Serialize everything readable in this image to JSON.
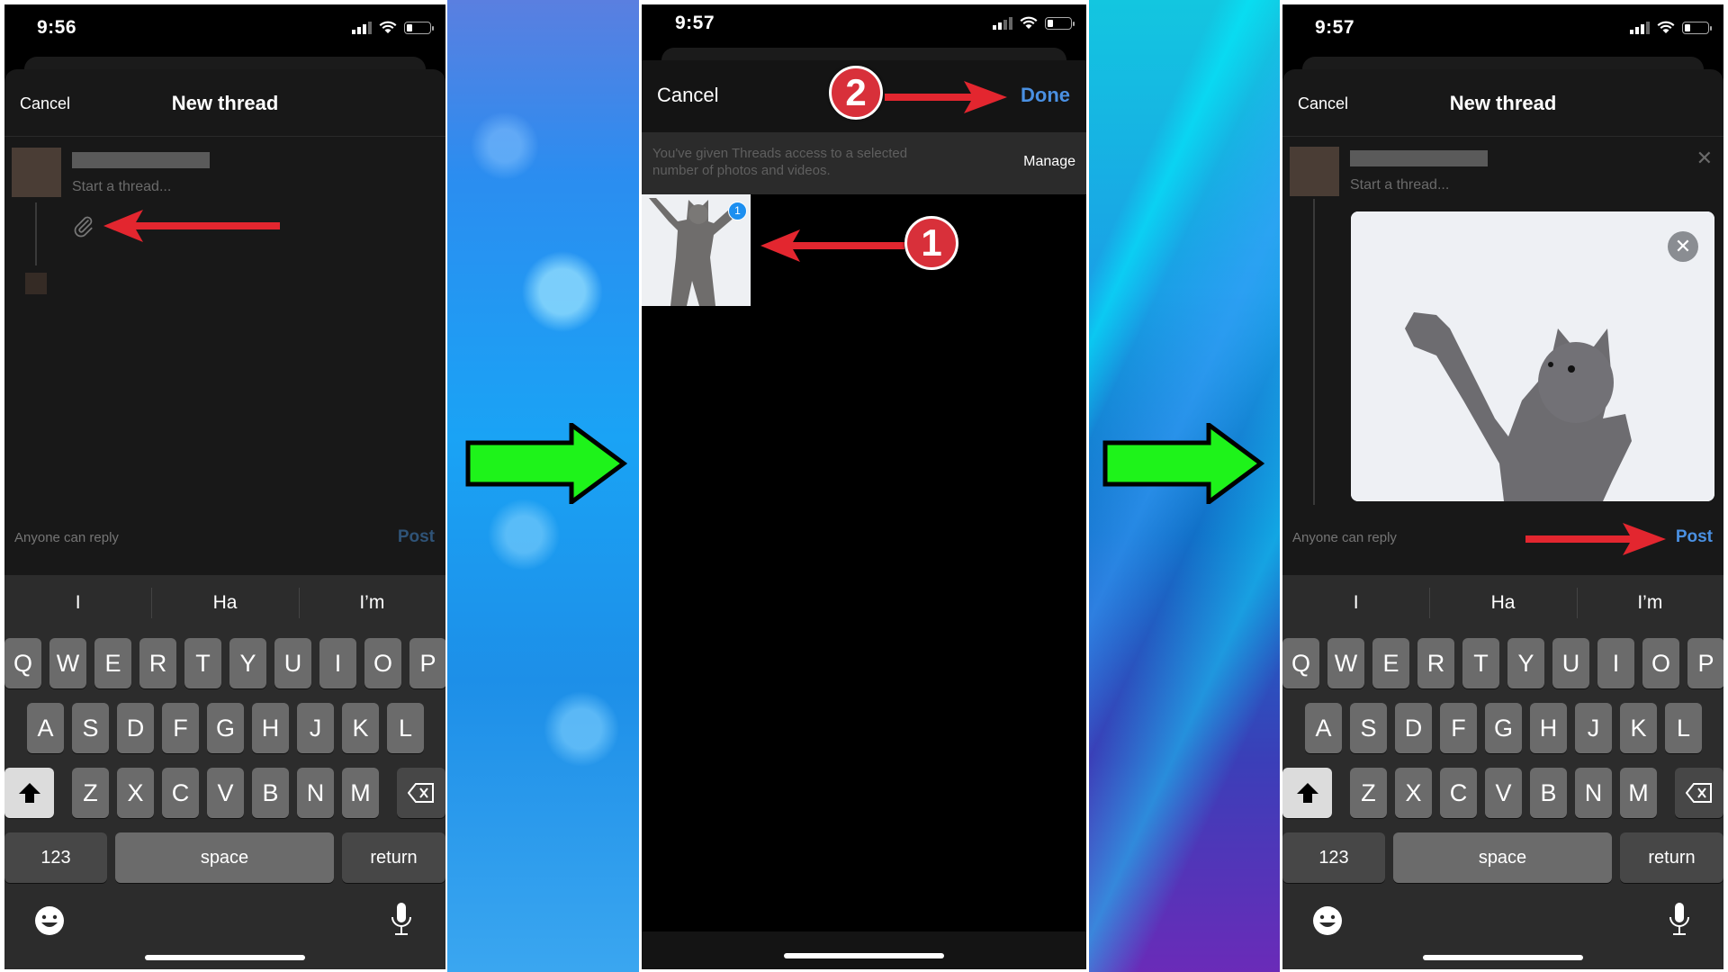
{
  "colors": {
    "accent_blue": "#4a90e2",
    "post_disabled": "#2f5377",
    "annotation_red": "#e3262f",
    "transition_arrow": "#1ef31a"
  },
  "screens": [
    {
      "status": {
        "time": "9:56"
      },
      "nav": {
        "cancel": "Cancel",
        "title": "New thread"
      },
      "composer": {
        "placeholder": "Start a thread...",
        "attach_icon": "paperclip-icon"
      },
      "footer": {
        "reply_setting": "Anyone can reply",
        "post": "Post"
      }
    },
    {
      "status": {
        "time": "9:57"
      },
      "nav": {
        "cancel": "Cancel",
        "done": "Done"
      },
      "access_banner": {
        "message": "You've given Threads access to a selected number of photos and videos.",
        "manage": "Manage"
      },
      "photos": [
        {
          "selected_index": "1",
          "description": "cat photo"
        }
      ],
      "annotations": {
        "step1": "1",
        "step2": "2"
      }
    },
    {
      "status": {
        "time": "9:57"
      },
      "nav": {
        "cancel": "Cancel",
        "title": "New thread"
      },
      "composer": {
        "placeholder": "Start a thread...",
        "attachment": "cat photo"
      },
      "footer": {
        "reply_setting": "Anyone can reply",
        "post": "Post"
      }
    }
  ],
  "keyboard": {
    "suggestions": [
      "I",
      "Ha",
      "I’m"
    ],
    "row1": [
      "Q",
      "W",
      "E",
      "R",
      "T",
      "Y",
      "U",
      "I",
      "O",
      "P"
    ],
    "row2": [
      "A",
      "S",
      "D",
      "F",
      "G",
      "H",
      "J",
      "K",
      "L"
    ],
    "row3": [
      "Z",
      "X",
      "C",
      "V",
      "B",
      "N",
      "M"
    ],
    "numbers": "123",
    "space": "space",
    "return": "return"
  }
}
